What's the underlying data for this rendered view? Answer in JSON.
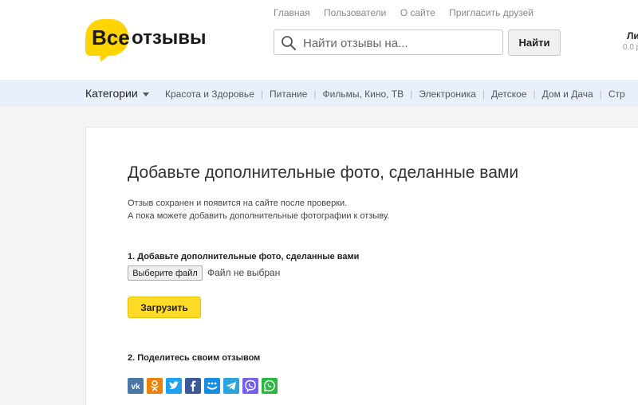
{
  "header": {
    "logo": {
      "word1": "Все",
      "word2": "отзывы"
    },
    "nav": [
      "Главная",
      "Пользователи",
      "О сайте",
      "Пригласить друзей"
    ],
    "search": {
      "placeholder": "Найти отзывы на...",
      "button_label": "Найти"
    },
    "account": {
      "label": "Ли",
      "balance": "0,0 р"
    }
  },
  "categories": {
    "main_label": "Категории",
    "items": [
      "Красота и Здоровье",
      "Питание",
      "Фильмы, Кино, ТВ",
      "Электроника",
      "Детское",
      "Дом и Дача",
      "Стр"
    ]
  },
  "main": {
    "title": "Добавьте дополнительные фото, сделанные вами",
    "description": [
      "Отзыв сохранен и появится на сайте после проверки.",
      "А пока можете добавить дополнительные фотографии к отзыву."
    ],
    "step1": {
      "label": "1. Добавьте дополнительные фото, сделанные вами",
      "file_button": "Выберите файл",
      "file_status": "Файл не выбран",
      "upload_button": "Загрузить"
    },
    "step2": {
      "label": "2. Поделитесь своим отзывом",
      "share_buttons": [
        {
          "icon": "vk-icon",
          "color": "#4a76a8"
        },
        {
          "icon": "odnoklassniki-icon",
          "color": "#ee8208"
        },
        {
          "icon": "twitter-icon",
          "color": "#1da1f2"
        },
        {
          "icon": "facebook-icon",
          "color": "#3b5998"
        },
        {
          "icon": "moimir-icon",
          "color": "#168de2"
        },
        {
          "icon": "telegram-icon",
          "color": "#2aa3df"
        },
        {
          "icon": "viber-icon",
          "color": "#7360f2"
        },
        {
          "icon": "whatsapp-icon",
          "color": "#2cb742"
        }
      ]
    }
  },
  "colors": {
    "brand_yellow": "#ffd400",
    "category_bar": "#e8f1fb",
    "upload_button": "#ffdb28"
  }
}
